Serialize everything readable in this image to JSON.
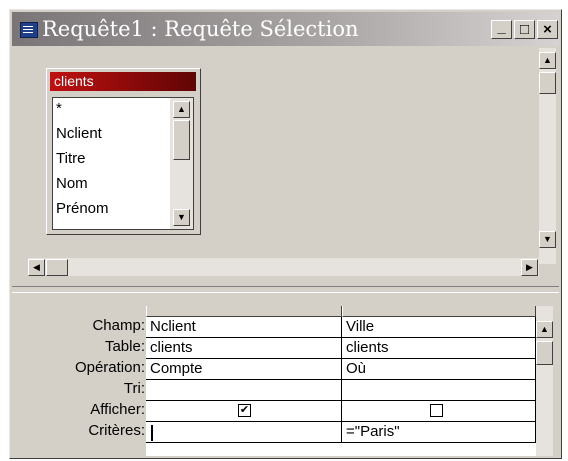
{
  "window": {
    "title": "Requête1 : Requête Sélection",
    "controls": {
      "minimize": "_",
      "maximize": "□",
      "close": "×"
    }
  },
  "table_box": {
    "name": "clients",
    "fields": [
      "*",
      "Nclient",
      "Titre",
      "Nom",
      "Prénom"
    ]
  },
  "grid": {
    "row_labels": [
      "Champ:",
      "Table:",
      "Opération:",
      "Tri:",
      "Afficher:",
      "Critères:"
    ],
    "columns": [
      {
        "champ": "Nclient",
        "table": "clients",
        "operation": "Compte",
        "tri": "",
        "afficher": true,
        "criteres": ""
      },
      {
        "champ": "Ville",
        "table": "clients",
        "operation": "Où",
        "tri": "",
        "afficher": false,
        "criteres": "=\"Paris\""
      }
    ]
  },
  "icons": {
    "up_arrow": "▲",
    "down_arrow": "▼",
    "left_arrow": "◀",
    "right_arrow": "▶",
    "check": "✔"
  }
}
